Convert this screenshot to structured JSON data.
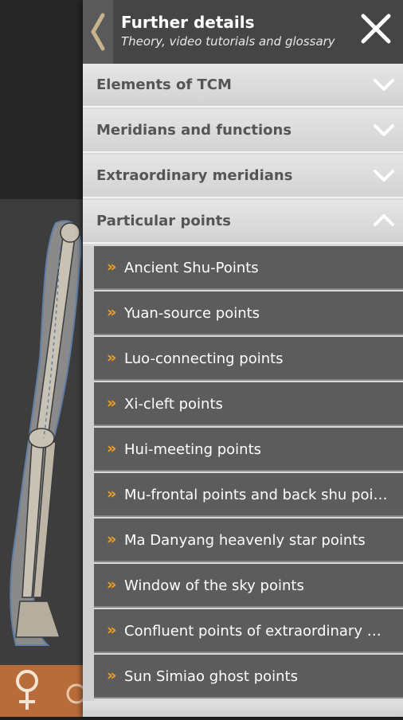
{
  "header": {
    "title": "Further details",
    "subtitle": "Theory, video tutorials and glossary"
  },
  "sections": [
    {
      "label": "Elements of TCM",
      "state": "collapsed"
    },
    {
      "label": "Meridians and functions",
      "state": "collapsed"
    },
    {
      "label": "Extraordinary meridians",
      "state": "collapsed"
    },
    {
      "label": "Particular points",
      "state": "expanded"
    }
  ],
  "particular_points": [
    {
      "label": "Ancient Shu-Points"
    },
    {
      "label": "Yuan-source points"
    },
    {
      "label": "Luo-connecting points"
    },
    {
      "label": "Xi-cleft points"
    },
    {
      "label": "Hui-meeting points"
    },
    {
      "label": "Mu-frontal points and back shu points"
    },
    {
      "label": "Ma Danyang heavenly star points"
    },
    {
      "label": "Window of the sky points"
    },
    {
      "label": "Confluent points of extraordinary meridians"
    },
    {
      "label": "Sun Simiao ghost points"
    }
  ],
  "icons": {
    "back": "chevron-left-icon",
    "close": "close-icon",
    "collapsed": "chevron-down-icon",
    "expanded": "chevron-up-icon",
    "item_marker": "double-angle-right-icon",
    "gender": "female-symbol-icon"
  },
  "colors": {
    "accent": "#f0a020",
    "header_bg": "#454545",
    "item_bg": "#5c5c5c",
    "section_text": "#555555",
    "toolbar_bg": "#b86c3a"
  }
}
